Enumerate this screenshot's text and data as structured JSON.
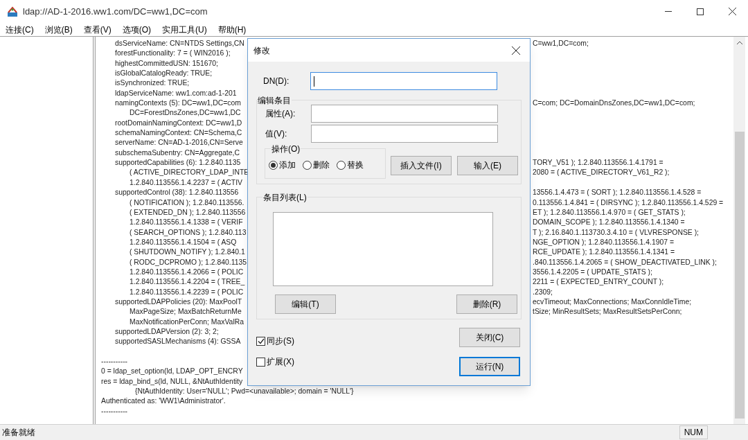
{
  "window": {
    "title": "ldap://AD-1-2016.ww1.com/DC=ww1,DC=com"
  },
  "menu": [
    {
      "label": "连接(C)"
    },
    {
      "label": "浏览(B)"
    },
    {
      "label": "查看(V)"
    },
    {
      "label": "选项(O)"
    },
    {
      "label": "实用工具(U)"
    },
    {
      "label": "帮助(H)"
    }
  ],
  "output": {
    "lines": [
      {
        "kind": "attr",
        "text": "dsServiceName: CN=NTDS Settings,CN",
        "right": "C=ww1,DC=com;"
      },
      {
        "kind": "attr",
        "text": "forestFunctionality: 7 = ( WIN2016 );"
      },
      {
        "kind": "attr",
        "text": "highestCommittedUSN: 151670;"
      },
      {
        "kind": "attr",
        "text": "isGlobalCatalogReady: TRUE;"
      },
      {
        "kind": "attr",
        "text": "isSynchronized: TRUE;"
      },
      {
        "kind": "attr",
        "text": "ldapServiceName: ww1.com:ad-1-201"
      },
      {
        "kind": "attr",
        "text": "namingContexts (5): DC=ww1,DC=com",
        "right": "C=com; DC=DomainDnsZones,DC=ww1,DC=com;"
      },
      {
        "kind": "cont",
        "text": "DC=ForestDnsZones,DC=ww1,DC"
      },
      {
        "kind": "attr",
        "text": "rootDomainNamingContext: DC=ww1,D"
      },
      {
        "kind": "attr",
        "text": "schemaNamingContext: CN=Schema,C"
      },
      {
        "kind": "attr",
        "text": "serverName: CN=AD-1-2016,CN=Serve"
      },
      {
        "kind": "attr",
        "text": "subschemaSubentry: CN=Aggregate,C"
      },
      {
        "kind": "attr",
        "text": "supportedCapabilities (6): 1.2.840.1135",
        "right": "TORY_V51 ); 1.2.840.113556.1.4.1791 ="
      },
      {
        "kind": "cont",
        "text": "( ACTIVE_DIRECTORY_LDAP_INTE",
        "right": "2080 = ( ACTIVE_DIRECTORY_V61_R2 );"
      },
      {
        "kind": "cont",
        "text": "1.2.840.113556.1.4.2237 = ( ACTIV"
      },
      {
        "kind": "attr",
        "text": "supportedControl (38): 1.2.840.113556",
        "right": "13556.1.4.473 = ( SORT ); 1.2.840.113556.1.4.528 ="
      },
      {
        "kind": "cont",
        "text": "( NOTIFICATION ); 1.2.840.113556.",
        "right": "0.113556.1.4.841 = ( DIRSYNC ); 1.2.840.113556.1.4.529 ="
      },
      {
        "kind": "cont",
        "text": "( EXTENDED_DN ); 1.2.840.113556",
        "right": "ET ); 1.2.840.113556.1.4.970 = ( GET_STATS );"
      },
      {
        "kind": "cont",
        "text": "1.2.840.113556.1.4.1338 = ( VERIF",
        "right": "DOMAIN_SCOPE ); 1.2.840.113556.1.4.1340 ="
      },
      {
        "kind": "cont",
        "text": "( SEARCH_OPTIONS ); 1.2.840.113",
        "right": "T ); 2.16.840.1.113730.3.4.10 = ( VLVRESPONSE );"
      },
      {
        "kind": "cont",
        "text": "1.2.840.113556.1.4.1504 = ( ASQ",
        "right": "NGE_OPTION ); 1.2.840.113556.1.4.1907 ="
      },
      {
        "kind": "cont",
        "text": "( SHUTDOWN_NOTIFY ); 1.2.840.1",
        "right": "RCE_UPDATE ); 1.2.840.113556.1.4.1341 ="
      },
      {
        "kind": "cont",
        "text": "( RODC_DCPROMO ); 1.2.840.1135",
        "right": ".840.113556.1.4.2065 = ( SHOW_DEACTIVATED_LINK );"
      },
      {
        "kind": "cont",
        "text": "1.2.840.113556.1.4.2066 = ( POLIC",
        "right": "3556.1.4.2205 = ( UPDATE_STATS );"
      },
      {
        "kind": "cont",
        "text": "1.2.840.113556.1.4.2204 = ( TREE_",
        "right": "2211 = ( EXPECTED_ENTRY_COUNT );"
      },
      {
        "kind": "cont",
        "text": "1.2.840.113556.1.4.2239 = ( POLIC",
        "right": ".2309;"
      },
      {
        "kind": "attr",
        "text": "supportedLDAPPolicies (20): MaxPoolT",
        "right": "ecvTimeout; MaxConnections; MaxConnIdleTime;"
      },
      {
        "kind": "cont",
        "text": "MaxPageSize; MaxBatchReturnMe",
        "right": "tSize; MinResultSets; MaxResultSetsPerConn;"
      },
      {
        "kind": "cont",
        "text": "MaxNotificationPerConn; MaxValRa"
      },
      {
        "kind": "attr",
        "text": "supportedLDAPVersion (2): 3; 2;"
      },
      {
        "kind": "attr",
        "text": "supportedSASLMechanisms (4): GSSA"
      },
      {
        "kind": "gap"
      },
      {
        "kind": "log",
        "text": "-----------"
      },
      {
        "kind": "log",
        "text": "0 = ldap_set_option(ld, LDAP_OPT_ENCRY"
      },
      {
        "kind": "log",
        "text": "res = ldap_bind_s(ld, NULL, &NtAuthIdentity"
      },
      {
        "kind": "deep",
        "text": "{NtAuthIdentity: User='NULL'; Pwd=<unavailable>; domain = 'NULL'}"
      },
      {
        "kind": "log",
        "text": "Authenticated as: 'WW1\\Administrator'."
      },
      {
        "kind": "log",
        "text": "-----------"
      }
    ]
  },
  "dialog": {
    "title": "修改",
    "dn": {
      "label": "DN(D):",
      "focused": true
    },
    "edit_group": {
      "title": "编辑条目",
      "attribute": {
        "label": "属性(A):"
      },
      "value": {
        "label": "值(V):"
      },
      "operation": {
        "title": "操作(O)",
        "options": [
          {
            "label": "添加",
            "selected": true
          },
          {
            "label": "删除",
            "selected": false
          },
          {
            "label": "替换",
            "selected": false
          }
        ]
      },
      "buttons": [
        {
          "label": "插入文件(I)"
        },
        {
          "label": "输入(E)"
        }
      ]
    },
    "list_group": {
      "title": "条目列表(L)",
      "buttons": [
        {
          "label": "编辑(T)"
        },
        {
          "label": "删除(R)"
        }
      ]
    },
    "options": [
      {
        "label": "同步(S)",
        "checked": true
      },
      {
        "label": "扩展(X)",
        "checked": false
      }
    ],
    "buttons": [
      {
        "label": "关闭(C)",
        "default": false
      },
      {
        "label": "运行(N)",
        "default": true
      }
    ]
  },
  "status_bar": {
    "text": "准备就绪",
    "indicators": [
      "NUM"
    ]
  }
}
